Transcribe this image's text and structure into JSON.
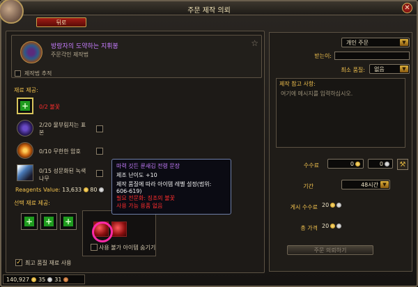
{
  "window": {
    "title": "주문 제작 의뢰",
    "close_label": "✕"
  },
  "toolbar": {
    "back_label": "뒤로"
  },
  "recipe": {
    "name": "방랑자의 도약하는 지휘봉",
    "subtitle": "주문각인 제작법",
    "track_label": "제작법 추적"
  },
  "reagents": {
    "section_label": "재료 제공:",
    "items": [
      {
        "text": "0/2 불꽃"
      },
      {
        "text_line1": "2/20 물부림치는 표",
        "text_line2": "본"
      },
      {
        "text": "0/10 무한한 암호"
      },
      {
        "text_line1": "0/15 성문화된 녹색",
        "text_line2": "나무"
      }
    ],
    "value_label": "Reagents Value:",
    "value_gold": "13,633",
    "value_silver": "80"
  },
  "optional": {
    "section_label": "선택 재료 제공:",
    "hide_label": "사용 불가 아이템 숨기기"
  },
  "tooltip": {
    "title": "마력 깃든 룬새김 전령 문장",
    "line1": "제조 난이도 +10",
    "line2": "제작 품질에 따라 아이템 레벨 설정(범위:",
    "line3": "606-619)",
    "req1": "필요 전문화: 징조의 불꽃",
    "req2": "사용 가능 용품 없음"
  },
  "bottom": {
    "check_label": "최고 품질 재료 사용"
  },
  "currency": {
    "gold": "140,927",
    "silver": "35",
    "copper": "31"
  },
  "right": {
    "order_type": "개인 주문",
    "recipient_label": "받는이:",
    "min_quality_label": "최소 품질:",
    "min_quality_value": "없음",
    "note_title": "제작 참고 사항:",
    "note_placeholder": "여기에 메시지를 입력하십시오.",
    "fee_label": "수수료",
    "fee_gold": "0",
    "fee_silver": "0",
    "duration_label": "기간",
    "duration_value": "48시간",
    "posting_fee_label": "게시 수수료",
    "posting_fee_gold": "20",
    "total_label": "총 가격",
    "total_gold": "20",
    "submit_label": "주문 의뢰하기"
  }
}
